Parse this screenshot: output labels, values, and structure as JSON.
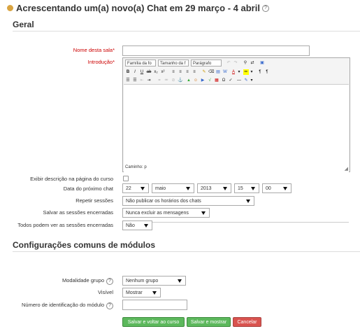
{
  "header": {
    "title": "Acrescentando um(a) novo(a) Chat em 29 março - 4 abril"
  },
  "sections": {
    "general": "Geral",
    "modules": "Configurações comuns de módulos"
  },
  "form": {
    "name_label": "Nome desta sala*",
    "intro_label": "Introdução*",
    "editor": {
      "font_family": "Família da fo",
      "font_size": "Tamanho da f",
      "paragraph": "Parágrafo",
      "path_label": "Caminho: p"
    },
    "display_desc_label": "Exibir descrição na página do curso",
    "next_chat_label": "Data do próximo chat",
    "next_chat": {
      "day": "22",
      "month": "maio",
      "year": "2013",
      "hour": "15",
      "minute": "00"
    },
    "repeat_label": "Repetir sessões",
    "repeat_value": "Não publicar os horários dos chats",
    "save_sessions_label": "Salvar as sessões encerradas",
    "save_sessions_value": "Nunca excluir as mensagens",
    "view_sessions_label": "Todos podem ver as sessões encerradas",
    "view_sessions_value": "Não",
    "group_mode_label": "Modalidade grupo",
    "group_mode_value": "Nenhum grupo",
    "visible_label": "Visível",
    "visible_value": "Mostrar",
    "idnumber_label": "Número de identificação do módulo"
  },
  "buttons": {
    "save_return": "Salvar e voltar ao curso",
    "save_display": "Salvar e mostrar",
    "cancel": "Cancelar"
  },
  "colors": {
    "required": "#cc0000",
    "green": "#5cb85c",
    "red": "#d9534f"
  }
}
